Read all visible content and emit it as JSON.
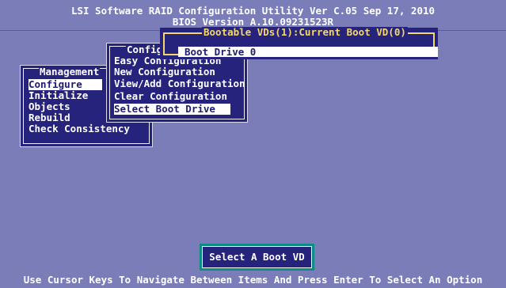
{
  "header": {
    "title": "LSI Software RAID Configuration Utility Ver C.05 Sep 17, 2010",
    "bios": "BIOS Version   A.10.09231523R"
  },
  "management_menu": {
    "title": "Management",
    "items": [
      "Configure",
      "Initialize",
      "Objects",
      "Rebuild",
      "Check Consistency"
    ],
    "selected": "Configure"
  },
  "configure_menu": {
    "title": "Configure",
    "items": [
      "Easy Configuration",
      "New Configuration",
      "View/Add Configuration",
      "Clear Configuration",
      "Select Boot Drive"
    ],
    "selected": "Select Boot Drive"
  },
  "boot_dialog": {
    "title": "Bootable VDs(1):Current Boot VD(0)",
    "drive": "Boot Drive 0"
  },
  "action_button": {
    "label": "Select A Boot VD"
  },
  "status_bar": {
    "text": "Use Cursor Keys To Navigate Between Items And Press Enter To Select An Option"
  },
  "colors": {
    "background": "#7b7db9",
    "panel": "#25237c",
    "highlight": "#ffffff",
    "dialog_border": "#f6d76a",
    "button_border": "#0c8c83"
  }
}
